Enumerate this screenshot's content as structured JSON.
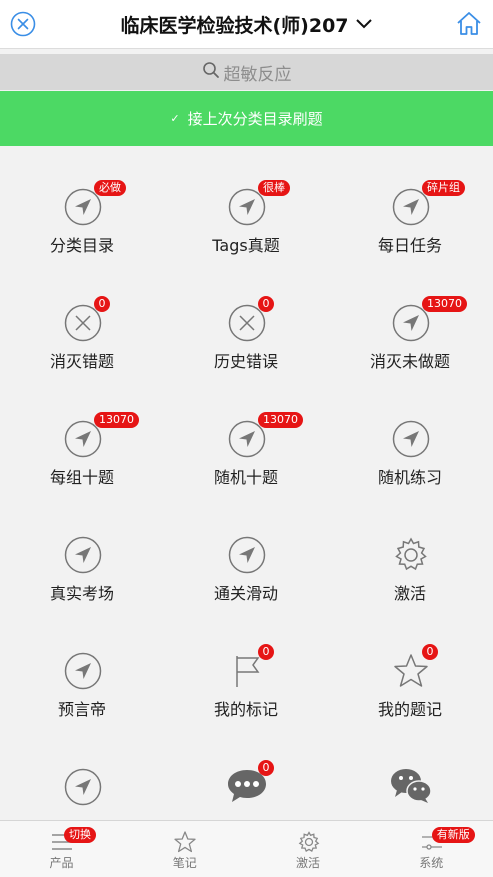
{
  "header": {
    "title": "临床医学检验技术(师)207",
    "close_icon": "close-circle-icon",
    "home_icon": "home-icon",
    "dropdown_icon": "chevron-down-icon"
  },
  "search": {
    "text": "超敏反应",
    "icon": "search-icon"
  },
  "banner": {
    "text": "接上次分类目录刷题",
    "icon": "check-icon",
    "color": "#4cd964"
  },
  "grid": [
    {
      "label": "分类目录",
      "icon": "navigation-arrow-icon",
      "badge": "必做"
    },
    {
      "label": "Tags真题",
      "icon": "navigation-arrow-icon",
      "badge": "很棒"
    },
    {
      "label": "每日任务",
      "icon": "navigation-arrow-icon",
      "badge": "碎片组"
    },
    {
      "label": "消灭错题",
      "icon": "x-circle-icon",
      "badge": "0"
    },
    {
      "label": "历史错误",
      "icon": "x-circle-icon",
      "badge": "0"
    },
    {
      "label": "消灭未做题",
      "icon": "navigation-arrow-icon",
      "badge": "13070"
    },
    {
      "label": "每组十题",
      "icon": "navigation-arrow-icon",
      "badge": "13070"
    },
    {
      "label": "随机十题",
      "icon": "navigation-arrow-icon",
      "badge": "13070"
    },
    {
      "label": "随机练习",
      "icon": "navigation-arrow-icon",
      "badge": ""
    },
    {
      "label": "真实考场",
      "icon": "navigation-arrow-icon",
      "badge": ""
    },
    {
      "label": "通关滑动",
      "icon": "navigation-arrow-icon",
      "badge": ""
    },
    {
      "label": "激活",
      "icon": "gear-icon",
      "badge": ""
    },
    {
      "label": "预言帝",
      "icon": "navigation-arrow-icon",
      "badge": ""
    },
    {
      "label": "我的标记",
      "icon": "flag-icon",
      "badge": "0"
    },
    {
      "label": "我的题记",
      "icon": "star-icon",
      "badge": "0"
    },
    {
      "label": "",
      "icon": "navigation-arrow-icon",
      "badge": ""
    },
    {
      "label": "",
      "icon": "chat-bubble-icon",
      "badge": "0"
    },
    {
      "label": "",
      "icon": "wechat-icon",
      "badge": ""
    }
  ],
  "tabbar": [
    {
      "label": "产品",
      "icon": "menu-icon",
      "badge": "切换"
    },
    {
      "label": "笔记",
      "icon": "star-outline-icon",
      "badge": ""
    },
    {
      "label": "激活",
      "icon": "gear-icon",
      "badge": ""
    },
    {
      "label": "系统",
      "icon": "settings-sliders-icon",
      "badge": "有新版"
    }
  ],
  "colors": {
    "accent_blue": "#3a8ee6",
    "badge_red": "#e61515",
    "icon_gray": "#777777"
  }
}
